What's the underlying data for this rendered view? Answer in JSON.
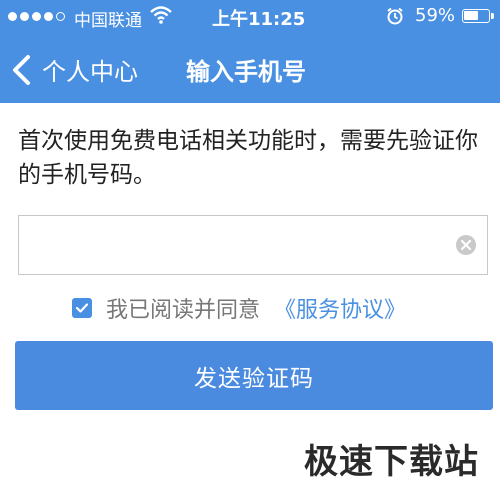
{
  "status_bar": {
    "carrier": "中国联通",
    "time": "上午11:25",
    "battery": "59%",
    "battery_level": 0.59
  },
  "nav": {
    "back_label": "个人中心",
    "title": "输入手机号"
  },
  "instruction": "首次使用免费电话相关功能时，需要先验证你的手机号码。",
  "phone_input": {
    "value": "",
    "placeholder": ""
  },
  "agreement": {
    "checked": true,
    "text": "我已阅读并同意",
    "link": "《服务协议》"
  },
  "send_button_label": "发送验证码",
  "watermark": "极速下载站",
  "colors": {
    "primary": "#4a90e2",
    "button": "#4a8be0",
    "text": "#222222",
    "muted": "#777777"
  },
  "icons": [
    "signal-icon",
    "wifi-icon",
    "alarm-icon",
    "battery-icon",
    "back-chevron-icon",
    "clear-icon",
    "checkmark-icon"
  ]
}
